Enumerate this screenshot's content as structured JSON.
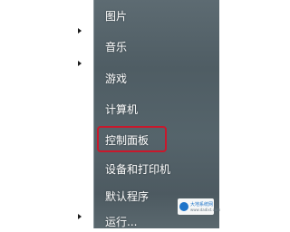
{
  "menu": {
    "items": [
      {
        "label": "图片",
        "name": "menu-item-pictures"
      },
      {
        "label": "音乐",
        "name": "menu-item-music"
      },
      {
        "label": "游戏",
        "name": "menu-item-games"
      },
      {
        "label": "计算机",
        "name": "menu-item-computer"
      },
      {
        "label": "控制面板",
        "name": "menu-item-control-panel"
      },
      {
        "label": "设备和打印机",
        "name": "menu-item-devices-printers"
      },
      {
        "label": "默认程序",
        "name": "menu-item-default-programs"
      },
      {
        "label": "运行...",
        "name": "menu-item-run"
      }
    ]
  },
  "highlight": {
    "color": "#c9182c",
    "target": "控制面板"
  },
  "watermark": {
    "text": "大地系统网",
    "subtext": "www.dadixt.com"
  }
}
